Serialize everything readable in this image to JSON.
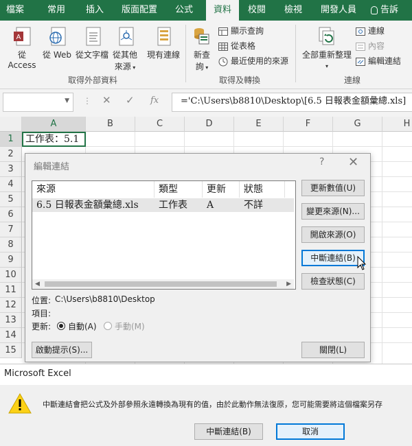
{
  "ribbon": {
    "tabs": [
      "檔案",
      "常用",
      "插入",
      "版面配置",
      "公式",
      "資料",
      "校閱",
      "檢視",
      "開發人員",
      "告訴我..."
    ],
    "active_tab": "資料",
    "groups": {
      "external": {
        "label": "取得外部資料",
        "buttons": [
          "從 Access",
          "從 Web",
          "從文字檔",
          "從其他",
          "來源"
        ],
        "existing": "現有連線"
      },
      "transform": {
        "label": "取得及轉換",
        "new_query": [
          "新查",
          "詢"
        ],
        "items": [
          "顯示查詢",
          "從表格",
          "最近使用的來源"
        ]
      },
      "connections": {
        "label": "連線",
        "refresh": "全部重新整理",
        "items": [
          "連線",
          "內容",
          "編輯連結"
        ]
      }
    }
  },
  "formula_bar": {
    "name_box": "",
    "fx": "fx",
    "formula": "='C:\\Users\\b8810\\Desktop\\[6.5 日報表金額彙總.xls]"
  },
  "sheet": {
    "columns": [
      "A",
      "B",
      "C",
      "D",
      "E",
      "F",
      "G",
      "H"
    ],
    "rows": [
      "1",
      "2",
      "3",
      "4",
      "5",
      "6",
      "7",
      "8",
      "9",
      "10",
      "11",
      "12",
      "13",
      "14",
      "15"
    ],
    "a1": "工作表：5.1"
  },
  "edit_links": {
    "title": "編輯連結",
    "help": "?",
    "close": "✕",
    "headers": [
      "來源",
      "類型",
      "更新",
      "狀態"
    ],
    "rows": [
      {
        "source": "6.5 日報表金額彙總.xls",
        "type": "工作表",
        "update": "A",
        "status": "不詳"
      }
    ],
    "buttons": [
      "更新數值(U)",
      "變更來源(N)...",
      "開啟來源(O)",
      "中斷連結(B)",
      "檢查狀態(C)"
    ],
    "location_label": "位置:",
    "location_value": "C:\\Users\\b8810\\Desktop",
    "item_label": "項目:",
    "update_label": "更新:",
    "auto_label": "自動(A)",
    "manual_label": "手動(M)",
    "startup_button": "啟動提示(S)...",
    "close_button": "關閉(L)"
  },
  "message_box": {
    "title": "Microsoft Excel",
    "text": "中斷連結會把公式及外部參照永遠轉換為現有的值，由於此動作無法復原，您可能需要將這個檔案另存",
    "break_button": "中斷連結(B)",
    "cancel_button": "取消"
  },
  "colors": {
    "excel_green": "#217346",
    "selection_border": "#217346",
    "focus_blue": "#0078d7",
    "warning_yellow": "#fcd116"
  }
}
